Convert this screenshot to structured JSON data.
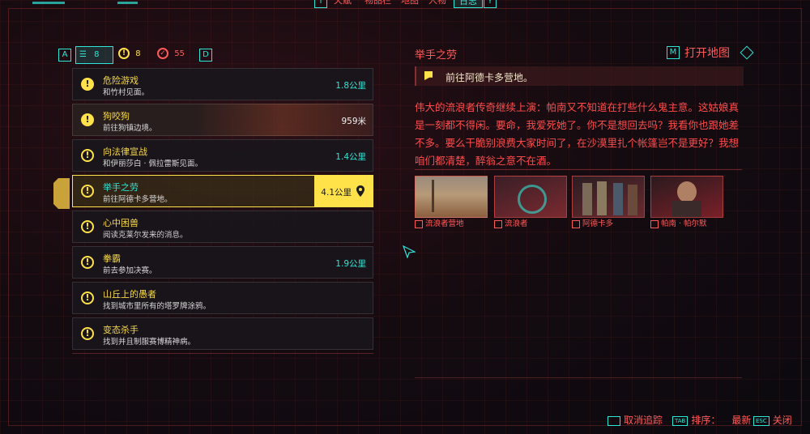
{
  "top_tabs": {
    "left_key": "T",
    "tabs": [
      "天赋",
      "物品栏",
      "地图",
      "人物",
      "日志"
    ],
    "active_index": 4,
    "right_key": "Y"
  },
  "filters": {
    "left_key": "A",
    "right_key": "D",
    "all_count": "8",
    "active_count": "8",
    "done_count": "55"
  },
  "quests": [
    {
      "title": "危险游戏",
      "subtitle": "和竹村见面。",
      "distance": "1.8公里",
      "icon": "alert-solid"
    },
    {
      "title": "狗咬狗",
      "subtitle": "前往狗镇边境。",
      "distance": "959米",
      "icon": "alert-solid"
    },
    {
      "title": "向法律宣战",
      "subtitle": "和伊丽莎白 · 佩拉雷斯见面。",
      "distance": "1.4公里",
      "icon": "alert-ring"
    },
    {
      "title": "举手之劳",
      "subtitle": "前往阿德卡多营地。",
      "distance": "4.1公里",
      "icon": "alert-ring"
    },
    {
      "title": "心中困兽",
      "subtitle": "阅读克莱尔发来的消息。",
      "distance": "",
      "icon": "alert-ring"
    },
    {
      "title": "拳霸",
      "subtitle": "前去参加决赛。",
      "distance": "1.9公里",
      "icon": "alert-ring"
    },
    {
      "title": "山丘上的愚者",
      "subtitle": "找到城市里所有的塔罗牌涂鸦。",
      "distance": "",
      "icon": "alert-ring"
    },
    {
      "title": "变态杀手",
      "subtitle": "找到并且制服赛博精神病。",
      "distance": "",
      "icon": "alert-ring"
    }
  ],
  "selected_index": 3,
  "detail": {
    "title": "举手之劳",
    "map_key": "M",
    "map_label": "打开地图",
    "objective": "前往阿德卡多营地。",
    "description": "伟大的流浪者传奇继续上演：帕南又不知道在打些什么鬼主意。这姑娘真是一刻都不得闲。要命，我爱死她了。你不是想回去吗？我看你也跟她差不多。要么干脆别浪费大家时间了，在沙漠里扎个帐篷岂不是更好？我想咱们都清楚，醉翁之意不在酒。",
    "codex": [
      {
        "label": "流浪者营地",
        "icon": "codex-icon"
      },
      {
        "label": "流浪者",
        "icon": "codex-icon"
      },
      {
        "label": "阿德卡多",
        "icon": "codex-icon"
      },
      {
        "label": "帕南 · 帕尔默",
        "icon": "codex-icon"
      }
    ]
  },
  "hints": {
    "untrack": "取消追踪",
    "sort_label": "排序：",
    "sort_value": "最新",
    "close": "关闭",
    "tab_key": "TAB",
    "esc_key": "ESC"
  },
  "colors": {
    "accent_red": "#ff5a5a",
    "accent_cyan": "#2ee6d6",
    "quest_yellow": "#ffe14a"
  }
}
